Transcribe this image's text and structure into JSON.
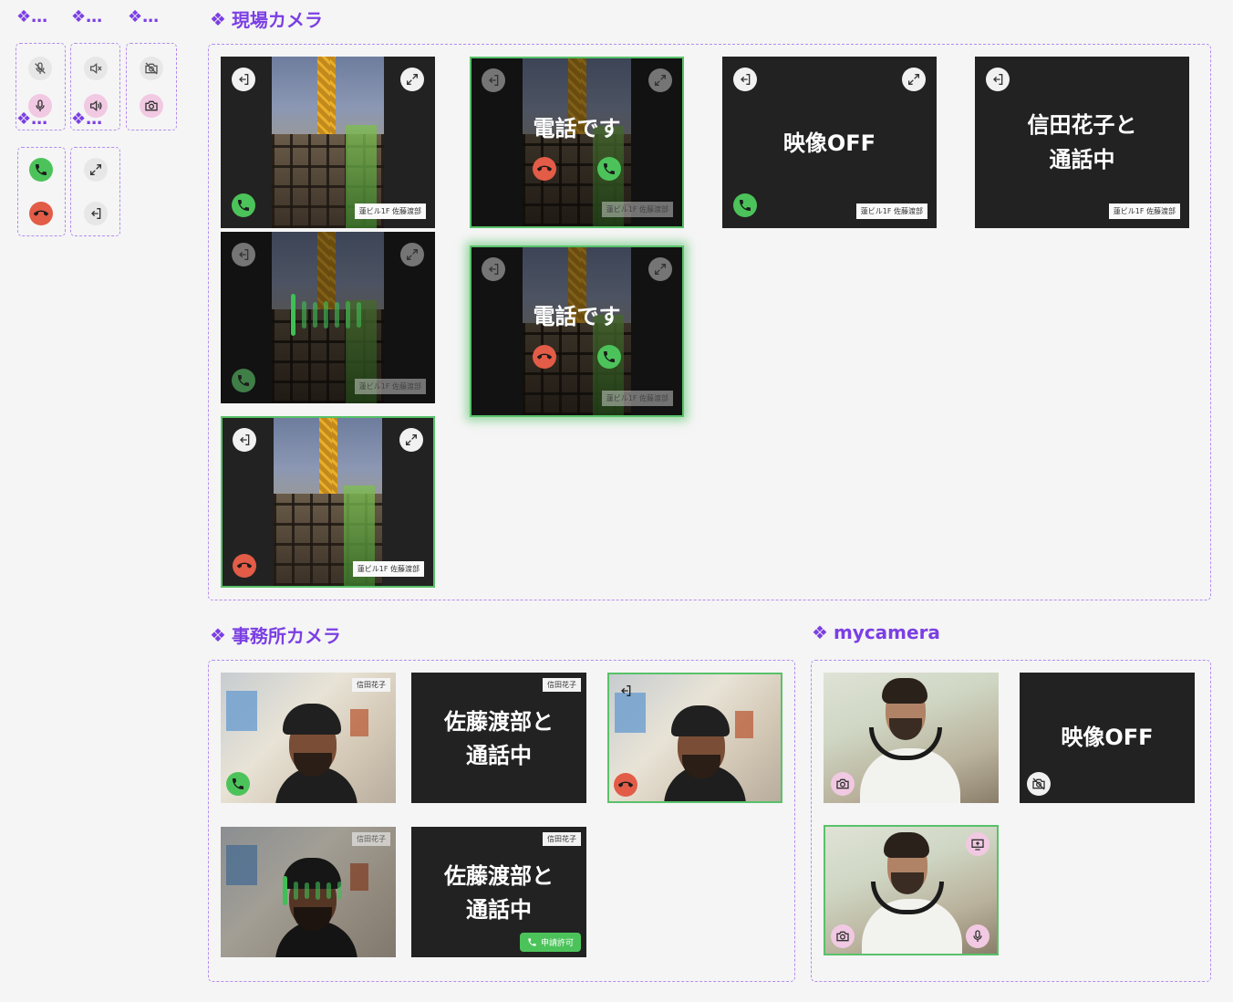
{
  "components": {
    "mini_titles": [
      "❖…",
      "❖…",
      "❖…",
      "❖…",
      "❖…"
    ],
    "genba_title": "現場カメラ",
    "office_title": "事務所カメラ",
    "mycamera_title": "mycamera",
    "diamond": "❖"
  },
  "genba": {
    "location_label": "蓮ビル1F 佐藤渡部",
    "calling_text": "電話です",
    "video_off": "映像OFF",
    "in_call_line1": "信田花子と",
    "in_call_line2": "通話中"
  },
  "office": {
    "name_tag": "信田花子",
    "in_call_line1": "佐藤渡部と",
    "in_call_line2": "通話中",
    "permit_label": "申請許可"
  },
  "mycamera": {
    "video_off": "映像OFF"
  },
  "colors": {
    "accent": "#7b3fe4",
    "accept": "#4cc35a",
    "reject": "#e25c47",
    "mute_pill": "#f1c9e2",
    "card_bg": "#222222"
  },
  "icons": [
    "mic-off-icon",
    "mic-icon",
    "speaker-off-icon",
    "speaker-icon",
    "camera-off-icon",
    "camera-icon",
    "phone-icon",
    "hangup-icon",
    "expand-icon",
    "exit-icon",
    "screen-share-icon"
  ]
}
